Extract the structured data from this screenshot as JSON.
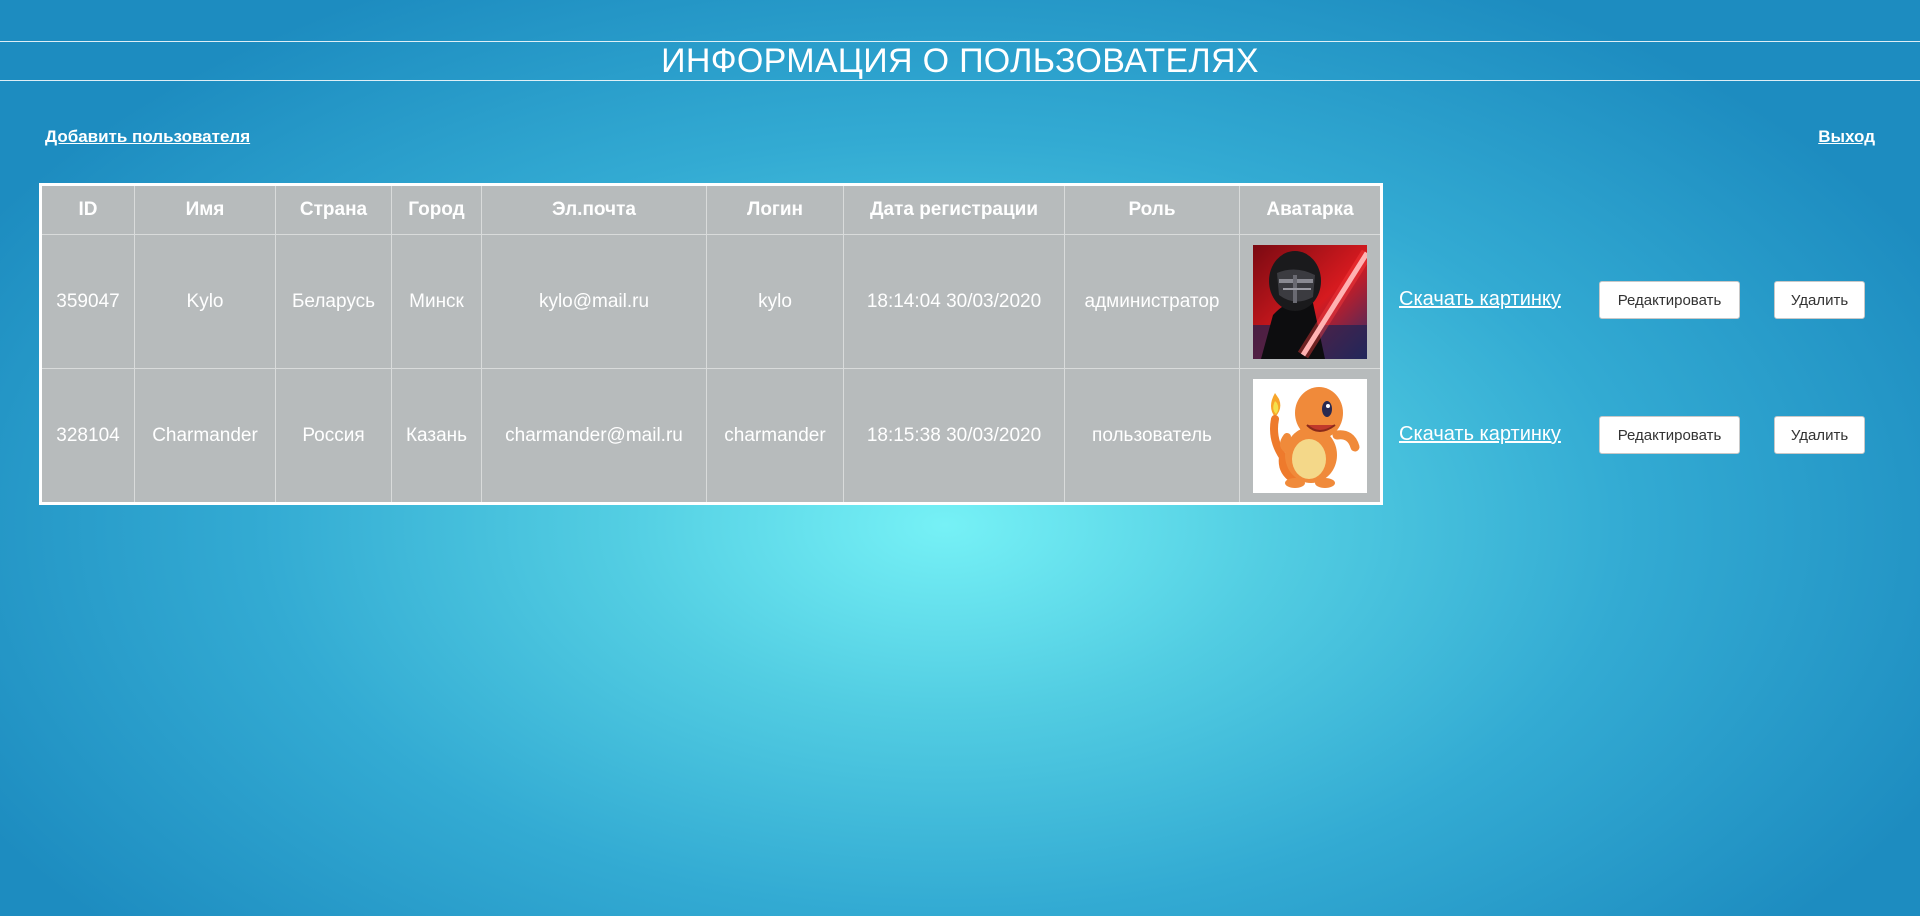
{
  "page": {
    "title": "ИНФОРМАЦИЯ О ПОЛЬЗОВАТЕЛЯХ",
    "add_user_link": "Добавить пользователя",
    "logout_link": "Выход"
  },
  "table": {
    "headers": [
      "ID",
      "Имя",
      "Страна",
      "Город",
      "Эл.почта",
      "Логин",
      "Дата регистрации",
      "Роль",
      "Аватарка"
    ],
    "rows": [
      {
        "id": "359047",
        "name": "Kylo",
        "country": "Беларусь",
        "city": "Минск",
        "email": "kylo@mail.ru",
        "login": "kylo",
        "registered": "18:14:04 30/03/2020",
        "role": "администратор",
        "avatar_icon": "kylo-ren-avatar"
      },
      {
        "id": "328104",
        "name": "Charmander",
        "country": "Россия",
        "city": "Казань",
        "email": "charmander@mail.ru",
        "login": "charmander",
        "registered": "18:15:38 30/03/2020",
        "role": "пользователь",
        "avatar_icon": "charmander-avatar"
      }
    ]
  },
  "actions": {
    "download_label": "Скачать картинку",
    "edit_label": "Редактировать",
    "delete_label": "Удалить"
  },
  "colors": {
    "background_center": "#76f1f6",
    "background_edge": "#1d8cc0",
    "table_bg": "#b7bbbc",
    "text": "#ffffff"
  }
}
